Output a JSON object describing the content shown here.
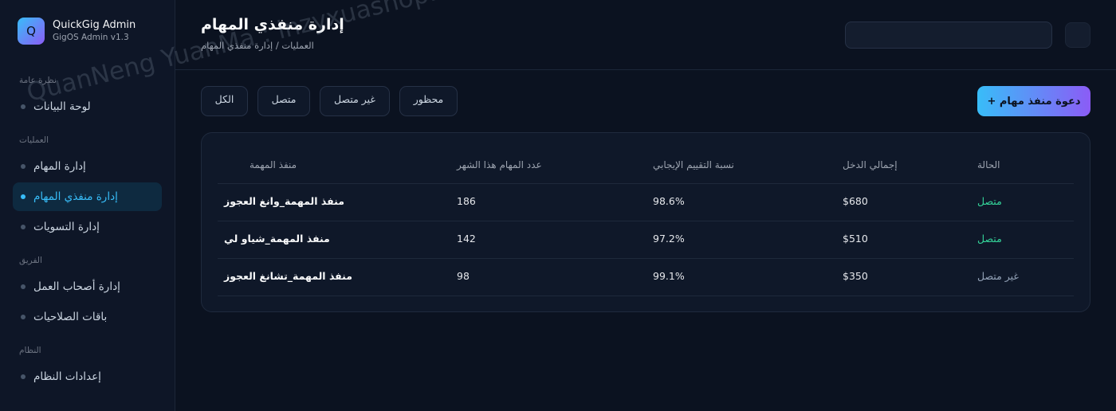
{
  "brand": {
    "name": "QuickGig Admin",
    "version": "GigOS Admin v1.3",
    "logo_letter": "Q"
  },
  "sidebar": {
    "sections": [
      {
        "label": "نظرة عامة"
      },
      {
        "label": "العمليات"
      },
      {
        "label": "الفريق"
      },
      {
        "label": "النظام"
      }
    ],
    "items": [
      {
        "label": "لوحة البيانات"
      },
      {
        "label": "إدارة المهام"
      },
      {
        "label": "إدارة منفذي المهام",
        "active": true
      },
      {
        "label": "إدارة التسويات"
      },
      {
        "label": "إدارة أصحاب العمل"
      },
      {
        "label": "باقات الصلاحيات"
      },
      {
        "label": "إعدادات النظام"
      }
    ]
  },
  "header": {
    "title": "إدارة منفذي المهام",
    "breadcrumb": "العمليات / إدارة منفذي المهام",
    "search_value": ""
  },
  "filters": [
    "الكل",
    "متصل",
    "غير متصل",
    "محظور"
  ],
  "invite_label": "+ دعوة منفذ مهام",
  "table": {
    "headers": {
      "executor": "منفذ المهمة",
      "tasks": "عدد المهام هذا الشهر",
      "rating": "نسبة التقييم الإيجابي",
      "income": "إجمالي الدخل",
      "status": "الحالة"
    },
    "rows": [
      {
        "executor": "منفذ المهمة_وانغ العجوز",
        "tasks": "186",
        "rating": "98.6%",
        "income": "$680",
        "status": "متصل"
      },
      {
        "executor": "منفذ المهمة_شياو لي",
        "tasks": "142",
        "rating": "97.2%",
        "income": "$510",
        "status": "متصل"
      },
      {
        "executor": "منفذ المهمة_تشانغ العجوز",
        "tasks": "98",
        "rating": "99.1%",
        "income": "$350",
        "status": "غير متصل"
      }
    ]
  },
  "colors": {
    "accent": "#38bdf8",
    "accent2": "#8b5cf6",
    "online": "#34d399",
    "offline": "#94a3b8"
  },
  "watermark": "QuanNeng YuanMa : inzyxuashop.com"
}
